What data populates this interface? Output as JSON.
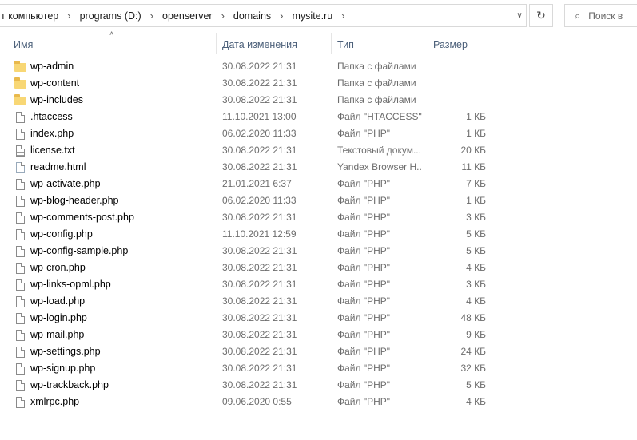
{
  "address": {
    "segments": [
      "т компьютер",
      "programs (D:)",
      "openserver",
      "domains",
      "mysite.ru"
    ],
    "refresh_icon": "refresh-icon"
  },
  "search": {
    "placeholder": "Поиск в"
  },
  "columns": {
    "name": "Имя",
    "date": "Дата изменения",
    "type": "Тип",
    "size": "Размер"
  },
  "files": [
    {
      "icon": "folder",
      "name": "wp-admin",
      "date": "30.08.2022 21:31",
      "type": "Папка с файлами",
      "size": ""
    },
    {
      "icon": "folder",
      "name": "wp-content",
      "date": "30.08.2022 21:31",
      "type": "Папка с файлами",
      "size": ""
    },
    {
      "icon": "folder",
      "name": "wp-includes",
      "date": "30.08.2022 21:31",
      "type": "Папка с файлами",
      "size": ""
    },
    {
      "icon": "file",
      "name": ".htaccess",
      "date": "11.10.2021 13:00",
      "type": "Файл \"HTACCESS\"",
      "size": "1 КБ"
    },
    {
      "icon": "file",
      "name": "index.php",
      "date": "06.02.2020 11:33",
      "type": "Файл \"PHP\"",
      "size": "1 КБ"
    },
    {
      "icon": "txt",
      "name": "license.txt",
      "date": "30.08.2022 21:31",
      "type": "Текстовый докум...",
      "size": "20 КБ"
    },
    {
      "icon": "html",
      "name": "readme.html",
      "date": "30.08.2022 21:31",
      "type": "Yandex Browser H...",
      "size": "11 КБ"
    },
    {
      "icon": "file",
      "name": "wp-activate.php",
      "date": "21.01.2021 6:37",
      "type": "Файл \"PHP\"",
      "size": "7 КБ"
    },
    {
      "icon": "file",
      "name": "wp-blog-header.php",
      "date": "06.02.2020 11:33",
      "type": "Файл \"PHP\"",
      "size": "1 КБ"
    },
    {
      "icon": "file",
      "name": "wp-comments-post.php",
      "date": "30.08.2022 21:31",
      "type": "Файл \"PHP\"",
      "size": "3 КБ"
    },
    {
      "icon": "file",
      "name": "wp-config.php",
      "date": "11.10.2021 12:59",
      "type": "Файл \"PHP\"",
      "size": "5 КБ"
    },
    {
      "icon": "file",
      "name": "wp-config-sample.php",
      "date": "30.08.2022 21:31",
      "type": "Файл \"PHP\"",
      "size": "5 КБ"
    },
    {
      "icon": "file",
      "name": "wp-cron.php",
      "date": "30.08.2022 21:31",
      "type": "Файл \"PHP\"",
      "size": "4 КБ"
    },
    {
      "icon": "file",
      "name": "wp-links-opml.php",
      "date": "30.08.2022 21:31",
      "type": "Файл \"PHP\"",
      "size": "3 КБ"
    },
    {
      "icon": "file",
      "name": "wp-load.php",
      "date": "30.08.2022 21:31",
      "type": "Файл \"PHP\"",
      "size": "4 КБ"
    },
    {
      "icon": "file",
      "name": "wp-login.php",
      "date": "30.08.2022 21:31",
      "type": "Файл \"PHP\"",
      "size": "48 КБ"
    },
    {
      "icon": "file",
      "name": "wp-mail.php",
      "date": "30.08.2022 21:31",
      "type": "Файл \"PHP\"",
      "size": "9 КБ"
    },
    {
      "icon": "file",
      "name": "wp-settings.php",
      "date": "30.08.2022 21:31",
      "type": "Файл \"PHP\"",
      "size": "24 КБ"
    },
    {
      "icon": "file",
      "name": "wp-signup.php",
      "date": "30.08.2022 21:31",
      "type": "Файл \"PHP\"",
      "size": "32 КБ"
    },
    {
      "icon": "file",
      "name": "wp-trackback.php",
      "date": "30.08.2022 21:31",
      "type": "Файл \"PHP\"",
      "size": "5 КБ"
    },
    {
      "icon": "file",
      "name": "xmlrpc.php",
      "date": "09.06.2020 0:55",
      "type": "Файл \"PHP\"",
      "size": "4 КБ"
    }
  ]
}
